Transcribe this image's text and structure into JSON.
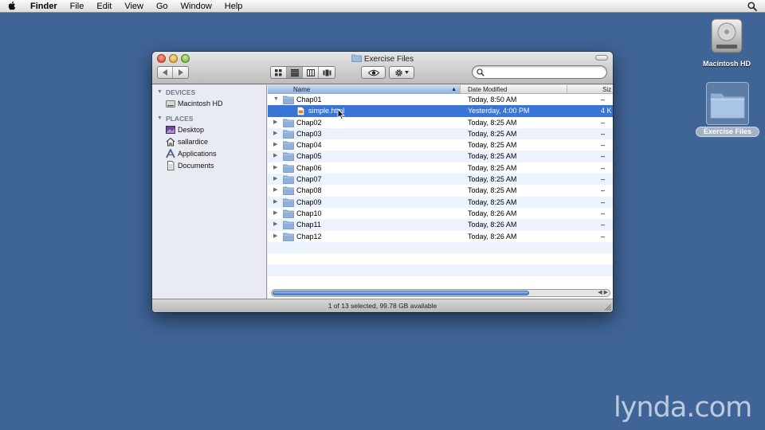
{
  "menubar": {
    "items": [
      "Finder",
      "File",
      "Edit",
      "View",
      "Go",
      "Window",
      "Help"
    ]
  },
  "desktop": {
    "icons": [
      {
        "label": "Macintosh HD",
        "icon": "hard-drive-icon"
      },
      {
        "label": "Exercise Files",
        "icon": "folder-icon"
      }
    ]
  },
  "window": {
    "title": "Exercise Files",
    "search": {
      "placeholder": "",
      "value": ""
    },
    "sidebar": {
      "sections": [
        {
          "heading": "DEVICES",
          "items": [
            {
              "label": "Macintosh HD",
              "icon": "drive-icon"
            }
          ]
        },
        {
          "heading": "PLACES",
          "items": [
            {
              "label": "Desktop",
              "icon": "desktop-icon"
            },
            {
              "label": "sallardice",
              "icon": "home-icon"
            },
            {
              "label": "Applications",
              "icon": "applications-icon"
            },
            {
              "label": "Documents",
              "icon": "documents-icon"
            }
          ]
        }
      ]
    },
    "columns": {
      "name": "Name",
      "date": "Date Modified",
      "size": "Siz"
    },
    "rows": [
      {
        "name": "Chap01",
        "date": "Today, 8:50 AM",
        "size": "–",
        "expanded": true,
        "kind": "folder"
      },
      {
        "name": "simple.html",
        "date": "Yesterday, 4:00 PM",
        "size": "4 K",
        "kind": "file",
        "selected": true
      },
      {
        "name": "Chap02",
        "date": "Today, 8:25 AM",
        "size": "–",
        "kind": "folder"
      },
      {
        "name": "Chap03",
        "date": "Today, 8:25 AM",
        "size": "–",
        "kind": "folder"
      },
      {
        "name": "Chap04",
        "date": "Today, 8:25 AM",
        "size": "–",
        "kind": "folder"
      },
      {
        "name": "Chap05",
        "date": "Today, 8:25 AM",
        "size": "–",
        "kind": "folder"
      },
      {
        "name": "Chap06",
        "date": "Today, 8:25 AM",
        "size": "–",
        "kind": "folder"
      },
      {
        "name": "Chap07",
        "date": "Today, 8:25 AM",
        "size": "–",
        "kind": "folder"
      },
      {
        "name": "Chap08",
        "date": "Today, 8:25 AM",
        "size": "–",
        "kind": "folder"
      },
      {
        "name": "Chap09",
        "date": "Today, 8:25 AM",
        "size": "–",
        "kind": "folder"
      },
      {
        "name": "Chap10",
        "date": "Today, 8:26 AM",
        "size": "–",
        "kind": "folder"
      },
      {
        "name": "Chap11",
        "date": "Today, 8:26 AM",
        "size": "–",
        "kind": "folder"
      },
      {
        "name": "Chap12",
        "date": "Today, 8:26 AM",
        "size": "–",
        "kind": "folder"
      }
    ],
    "status": "1 of 13 selected, 99.78 GB available"
  },
  "watermark": "lynda.com",
  "colors": {
    "desktop": "#3f6496",
    "selection": "#3875d7",
    "row_alt": "#edf3fe",
    "sidebar": "#e8ecf2"
  }
}
